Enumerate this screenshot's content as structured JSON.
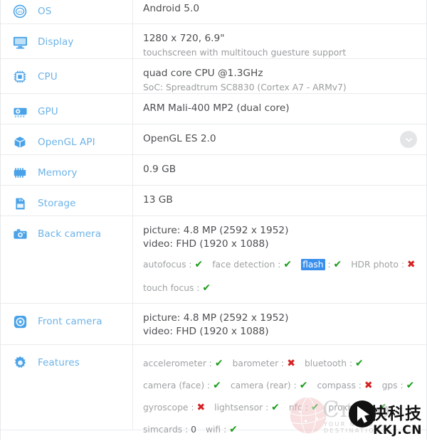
{
  "rows": [
    {
      "id": "os",
      "icon": "os-badge-icon",
      "label": "OS",
      "primary": "Android 5.0",
      "secondary": ""
    },
    {
      "id": "display",
      "icon": "monitor-icon",
      "label": "Display",
      "primary": "1280 x 720, 6.9\"",
      "secondary": "touchscreen with multitouch guesture support"
    },
    {
      "id": "cpu",
      "icon": "cpu-chip-icon",
      "label": "CPU",
      "primary": "quad core CPU @1.3GHz",
      "secondary": "SoC: Spreadtrum SC8830 (Cortex A7 - ARMv7)"
    },
    {
      "id": "gpu",
      "icon": "graphics-card-icon",
      "label": "GPU",
      "primary": "ARM Mali-400 MP2 (dual core)",
      "secondary": ""
    },
    {
      "id": "opengl",
      "icon": "cube-icon",
      "label": "OpenGL API",
      "primary": "OpenGL ES 2.0",
      "secondary": ""
    },
    {
      "id": "memory",
      "icon": "memory-chip-icon",
      "label": "Memory",
      "primary": "0.9 GB",
      "secondary": ""
    },
    {
      "id": "storage",
      "icon": "sd-card-icon",
      "label": "Storage",
      "primary": "13 GB",
      "secondary": ""
    },
    {
      "id": "back_camera",
      "icon": "camera-icon",
      "label": "Back camera",
      "primary": "picture: 4.8 MP (2592 x 1952)",
      "secondary": "video: FHD (1920 x 1088)"
    },
    {
      "id": "front_camera",
      "icon": "front-camera-icon",
      "label": "Front camera",
      "primary": "picture: 4.8 MP (2592 x 1952)",
      "secondary": "video: FHD (1920 x 1088)"
    },
    {
      "id": "features",
      "icon": "gear-icon",
      "label": "Features",
      "primary": "",
      "secondary": ""
    }
  ],
  "back_camera_flags_line1": [
    {
      "name": "autofocus",
      "value": "yes"
    },
    {
      "name": "face detection",
      "value": "yes"
    },
    {
      "name": "flash",
      "value": "yes",
      "selected": true
    },
    {
      "name": "HDR photo",
      "value": "no"
    }
  ],
  "back_camera_flags_line2": [
    {
      "name": "touch focus",
      "value": "yes"
    }
  ],
  "features_line1": [
    {
      "name": "accelerometer",
      "value": "yes"
    },
    {
      "name": "barometer",
      "value": "no"
    },
    {
      "name": "bluetooth",
      "value": "yes"
    }
  ],
  "features_line2": [
    {
      "name": "camera (face)",
      "value": "yes"
    },
    {
      "name": "camera (rear)",
      "value": "yes"
    },
    {
      "name": "compass",
      "value": "no"
    },
    {
      "name": "gps",
      "value": "yes"
    }
  ],
  "features_line3": [
    {
      "name": "gyroscope",
      "value": "no"
    },
    {
      "name": "lightsensor",
      "value": "yes"
    },
    {
      "name": "nfc",
      "value": "yes"
    },
    {
      "name": "proximity",
      "value": "yes"
    }
  ],
  "features_line4": [
    {
      "name": "simcards",
      "value": "0"
    },
    {
      "name": "wifi",
      "value": "yes"
    }
  ],
  "glyphs": {
    "yes": "✔",
    "no": "✖",
    "separator": ":"
  },
  "opengl_expand": {
    "icon": "chevron-down-icon"
  },
  "watermark": {
    "brand_cn": "快科技",
    "domain": "KKJ.CN",
    "ghost_text": "Cnmo",
    "tagline": "YOUR NEWS DESTINATION",
    "globe_icon": "globe-icon",
    "cursor_icon": "cursor-arrow-icon"
  },
  "colors": {
    "label_blue": "#6cb3e8",
    "icon_blue": "#4aa3e8",
    "value_grey": "#4d4f51",
    "sub_grey": "#9a9c9e",
    "flag_grey": "#a0a2a4",
    "yes_green": "#1a9d1a",
    "no_red": "#d62020",
    "selection_blue": "#3b8fec",
    "divider": "#e9ebec"
  }
}
